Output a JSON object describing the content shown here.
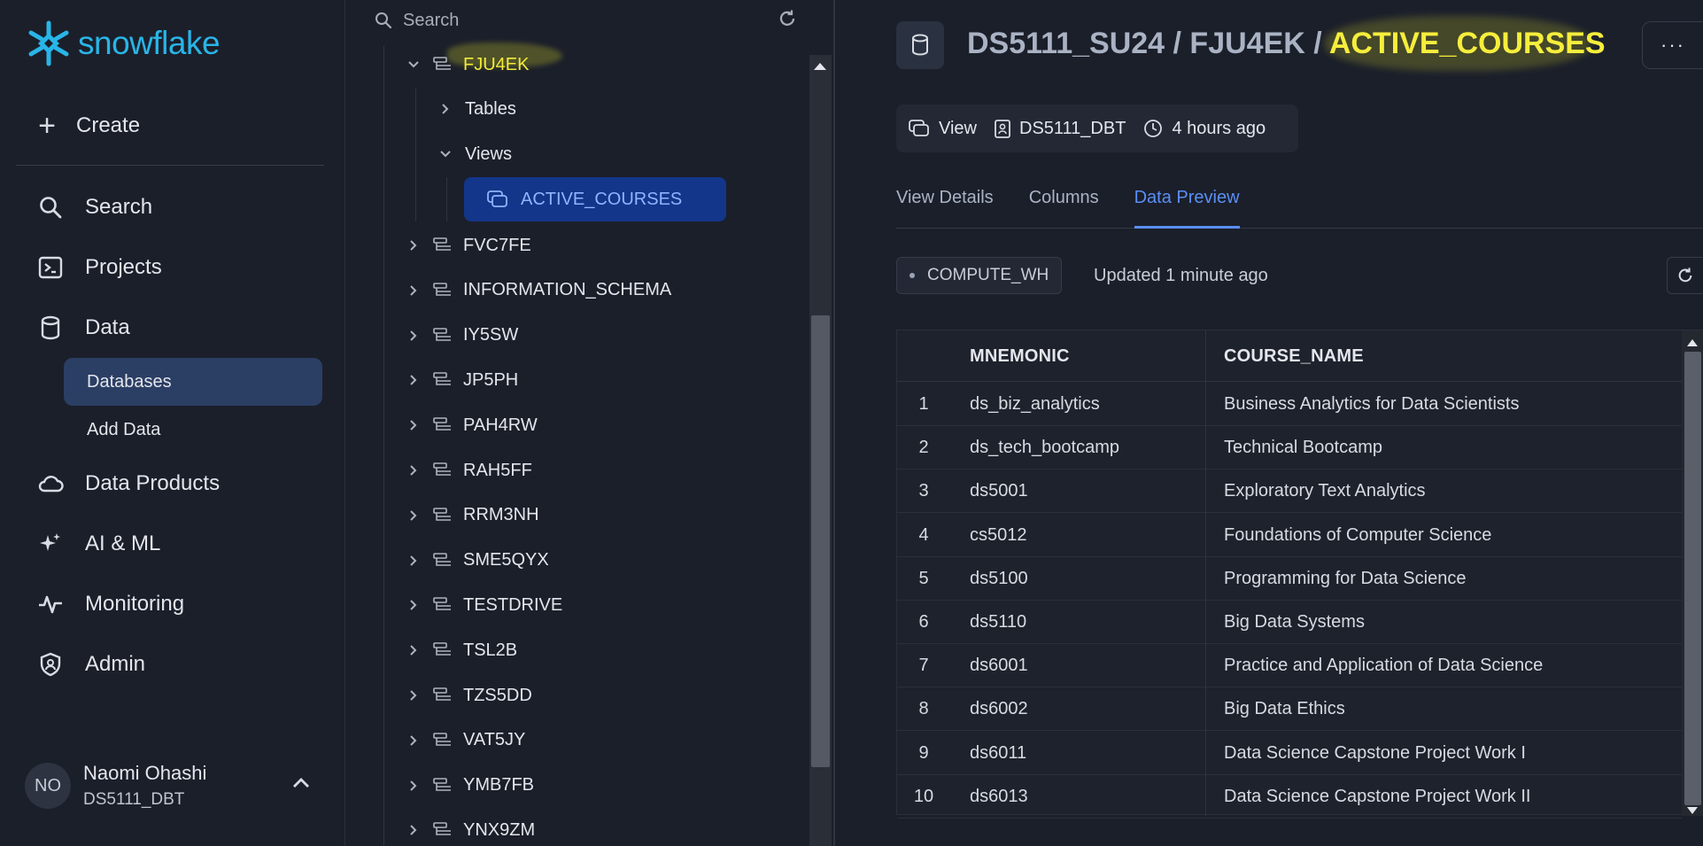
{
  "app": {
    "logo_text": "snowflake"
  },
  "nav": {
    "create_label": "Create",
    "items": [
      {
        "label": "Search",
        "icon": "search-icon"
      },
      {
        "label": "Projects",
        "icon": "terminal-icon"
      },
      {
        "label": "Data",
        "icon": "database-icon"
      },
      {
        "label": "Data Products",
        "icon": "cloud-icon"
      },
      {
        "label": "AI & ML",
        "icon": "sparkle-icon"
      },
      {
        "label": "Monitoring",
        "icon": "pulse-icon"
      },
      {
        "label": "Admin",
        "icon": "shield-user-icon"
      }
    ],
    "sub_items": [
      {
        "label": "Databases",
        "active": true
      },
      {
        "label": "Add Data",
        "active": false
      }
    ],
    "user": {
      "initials": "NO",
      "name": "Naomi Ohashi",
      "role": "DS5111_DBT"
    }
  },
  "tree": {
    "search_placeholder": "Search",
    "expanded_schema": "FJU4EK",
    "folders": [
      "Tables",
      "Views"
    ],
    "active_view": "ACTIVE_COURSES",
    "schemas": [
      "FVC7FE",
      "INFORMATION_SCHEMA",
      "IY5SW",
      "JP5PH",
      "PAH4RW",
      "RAH5FF",
      "RRM3NH",
      "SME5QYX",
      "TESTDRIVE",
      "TSL2B",
      "TZS5DD",
      "VAT5JY",
      "YMB7FB",
      "YNX9ZM"
    ]
  },
  "detail": {
    "breadcrumb": {
      "database": "DS5111_SU24",
      "sep1": " / ",
      "schema": "FJU4EK",
      "sep2": " / ",
      "object": "ACTIVE_COURSES"
    },
    "more_label": "···",
    "meta": {
      "type": "View",
      "owner": "DS5111_DBT",
      "time": "4 hours ago"
    },
    "tabs": [
      "View Details",
      "Columns",
      "Data Preview"
    ],
    "active_tab": "Data Preview",
    "warehouse": "COMPUTE_WH",
    "updated": "Updated 1 minute ago",
    "table": {
      "columns": [
        "MNEMONIC",
        "COURSE_NAME"
      ],
      "rows": [
        {
          "n": "1",
          "mnemonic": "ds_biz_analytics",
          "course": "Business Analytics for Data Scientists"
        },
        {
          "n": "2",
          "mnemonic": "ds_tech_bootcamp",
          "course": "Technical Bootcamp"
        },
        {
          "n": "3",
          "mnemonic": "ds5001",
          "course": "Exploratory Text Analytics"
        },
        {
          "n": "4",
          "mnemonic": "cs5012",
          "course": "Foundations of Computer Science"
        },
        {
          "n": "5",
          "mnemonic": "ds5100",
          "course": "Programming for Data Science"
        },
        {
          "n": "6",
          "mnemonic": "ds5110",
          "course": "Big Data Systems"
        },
        {
          "n": "7",
          "mnemonic": "ds6001",
          "course": "Practice and Application of Data Science"
        },
        {
          "n": "8",
          "mnemonic": "ds6002",
          "course": "Big Data Ethics"
        },
        {
          "n": "9",
          "mnemonic": "ds6011",
          "course": "Data Science Capstone Project Work I"
        },
        {
          "n": "10",
          "mnemonic": "ds6013",
          "course": "Data Science Capstone Project Work II"
        }
      ]
    }
  },
  "colors": {
    "accent": "#5b8ef5",
    "brand": "#29b5e8",
    "highlight": "#f6ee3c",
    "selected_bg": "#13368a"
  }
}
